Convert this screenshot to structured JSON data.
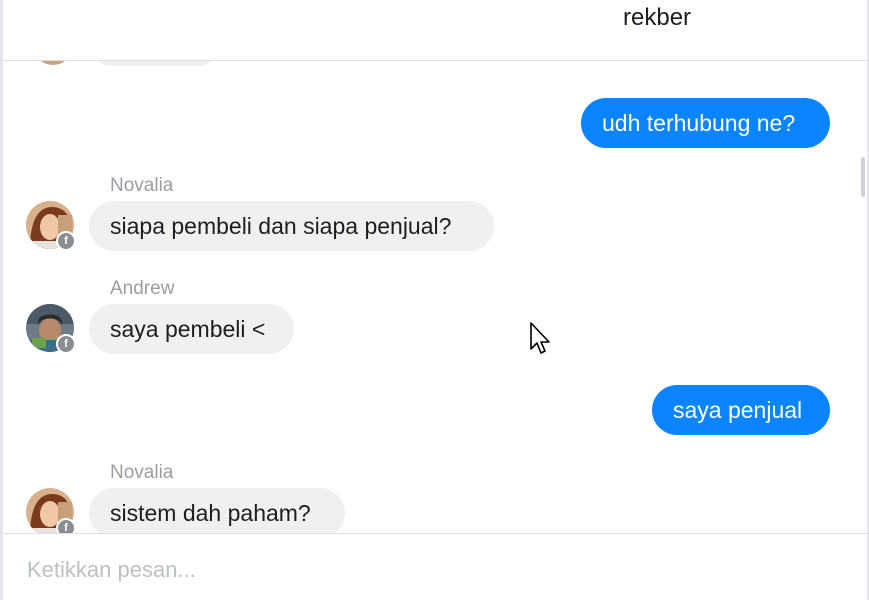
{
  "window": {
    "title": "rekber"
  },
  "messages": [
    {
      "type": "outgoing",
      "text": "udh terhubung ne?"
    },
    {
      "type": "incoming",
      "sender": "Novalia",
      "text": "siapa pembeli dan siapa penjual?"
    },
    {
      "type": "incoming",
      "sender": "Andrew",
      "text": "saya pembeli <"
    },
    {
      "type": "outgoing",
      "text": "saya penjual"
    },
    {
      "type": "incoming",
      "sender": "Novalia",
      "text": "sistem dah paham?"
    }
  ],
  "composer": {
    "placeholder": "Ketikkan pesan..."
  },
  "colors": {
    "outgoing_bubble": "#0a84ff",
    "incoming_bubble": "#f0f0f0",
    "badge": "#8a8d91"
  },
  "icons": {
    "platform_badge": "facebook-icon",
    "cursor": "mouse-pointer-icon"
  }
}
